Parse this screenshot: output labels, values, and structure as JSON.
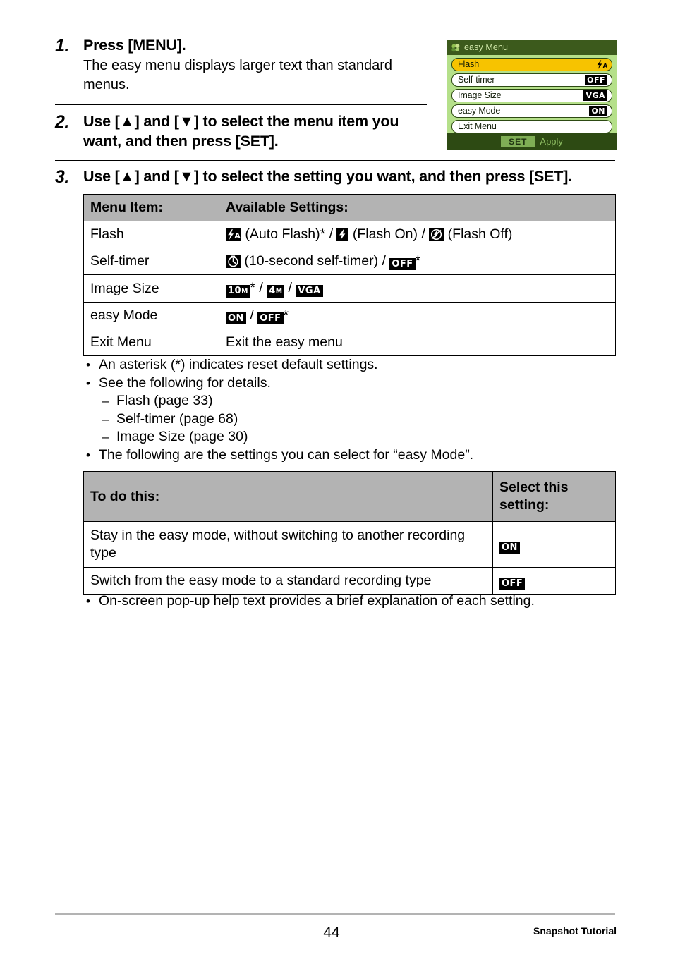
{
  "steps": [
    {
      "number": "1.",
      "title": "Press [MENU].",
      "description": "The easy menu displays larger text than standard menus."
    },
    {
      "number": "2.",
      "title": "Use [▲] and [▼] to select the menu item you want, and then press [SET]."
    },
    {
      "number": "3.",
      "title": "Use [▲] and [▼] to select the setting you want, and then press [SET]."
    }
  ],
  "lcd": {
    "title": "easy Menu",
    "rows": [
      {
        "label": "Flash",
        "value_icon": "flash-auto-icon",
        "value_text": "",
        "selected": true
      },
      {
        "label": "Self-timer",
        "value_icon": "",
        "value_text": "OFF",
        "selected": false
      },
      {
        "label": "Image Size",
        "value_icon": "",
        "value_text": "VGA",
        "selected": false
      },
      {
        "label": "easy Mode",
        "value_icon": "",
        "value_text": "ON",
        "selected": false
      },
      {
        "label": "Exit Menu",
        "value_icon": "",
        "value_text": "",
        "selected": false
      }
    ],
    "footer": {
      "key": "SET",
      "action": "Apply"
    }
  },
  "settings_table": {
    "headers": [
      "Menu Item:",
      "Available Settings:"
    ],
    "rows": [
      {
        "item": "Flash",
        "parts": [
          {
            "type": "icon",
            "name": "flash-auto-icon"
          },
          {
            "type": "text",
            "value": " (Auto Flash)* / "
          },
          {
            "type": "icon",
            "name": "flash-on-icon"
          },
          {
            "type": "text",
            "value": " (Flash On) / "
          },
          {
            "type": "icon",
            "name": "flash-off-icon"
          },
          {
            "type": "text",
            "value": " (Flash Off)"
          }
        ]
      },
      {
        "item": "Self-timer",
        "parts": [
          {
            "type": "icon",
            "name": "self-timer-icon"
          },
          {
            "type": "text",
            "value": " (10-second self-timer) / "
          },
          {
            "type": "badge",
            "value": "OFF"
          },
          {
            "type": "text",
            "value": "*"
          }
        ]
      },
      {
        "item": "Image Size",
        "parts": [
          {
            "type": "badge-mm",
            "value": "10",
            "unit": "M"
          },
          {
            "type": "text",
            "value": "* / "
          },
          {
            "type": "badge-mm",
            "value": "4",
            "unit": "M"
          },
          {
            "type": "text",
            "value": " / "
          },
          {
            "type": "badge",
            "value": "VGA"
          }
        ]
      },
      {
        "item": "easy Mode",
        "parts": [
          {
            "type": "badge",
            "value": "ON"
          },
          {
            "type": "text",
            "value": " / "
          },
          {
            "type": "badge",
            "value": "OFF"
          },
          {
            "type": "text",
            "value": "*"
          }
        ]
      },
      {
        "item": "Exit Menu",
        "parts": [
          {
            "type": "text",
            "value": "Exit the easy menu"
          }
        ]
      }
    ]
  },
  "notes": [
    {
      "level": "top",
      "mark": "•",
      "text": "An asterisk (*) indicates reset default settings."
    },
    {
      "level": "top",
      "mark": "•",
      "text": "See the following for details."
    },
    {
      "level": "sub",
      "mark": "–",
      "text": "Flash (page 33)"
    },
    {
      "level": "sub",
      "mark": "–",
      "text": "Self-timer (page 68)"
    },
    {
      "level": "sub",
      "mark": "–",
      "text": "Image Size (page 30)"
    },
    {
      "level": "top",
      "mark": "•",
      "text": "The following are the settings you can select for “easy Mode”."
    }
  ],
  "easy_mode_table": {
    "headers": [
      "To do this:",
      "Select this setting:"
    ],
    "rows": [
      {
        "description": "Stay in the easy mode, without switching to another recording type",
        "setting": "ON"
      },
      {
        "description": "Switch from the easy mode to a standard recording type",
        "setting": "OFF"
      }
    ]
  },
  "final_note": {
    "mark": "•",
    "text": "On-screen pop-up help text provides a brief explanation of each setting."
  },
  "footer": {
    "page_number": "44",
    "section": "Snapshot Tutorial"
  },
  "colors": {
    "table_header_bg": "#b3b3b3",
    "lcd_selected_row": "#f7c300",
    "lcd_body_bg": "#b5e08a",
    "lcd_chrome": "#2d4a13"
  }
}
